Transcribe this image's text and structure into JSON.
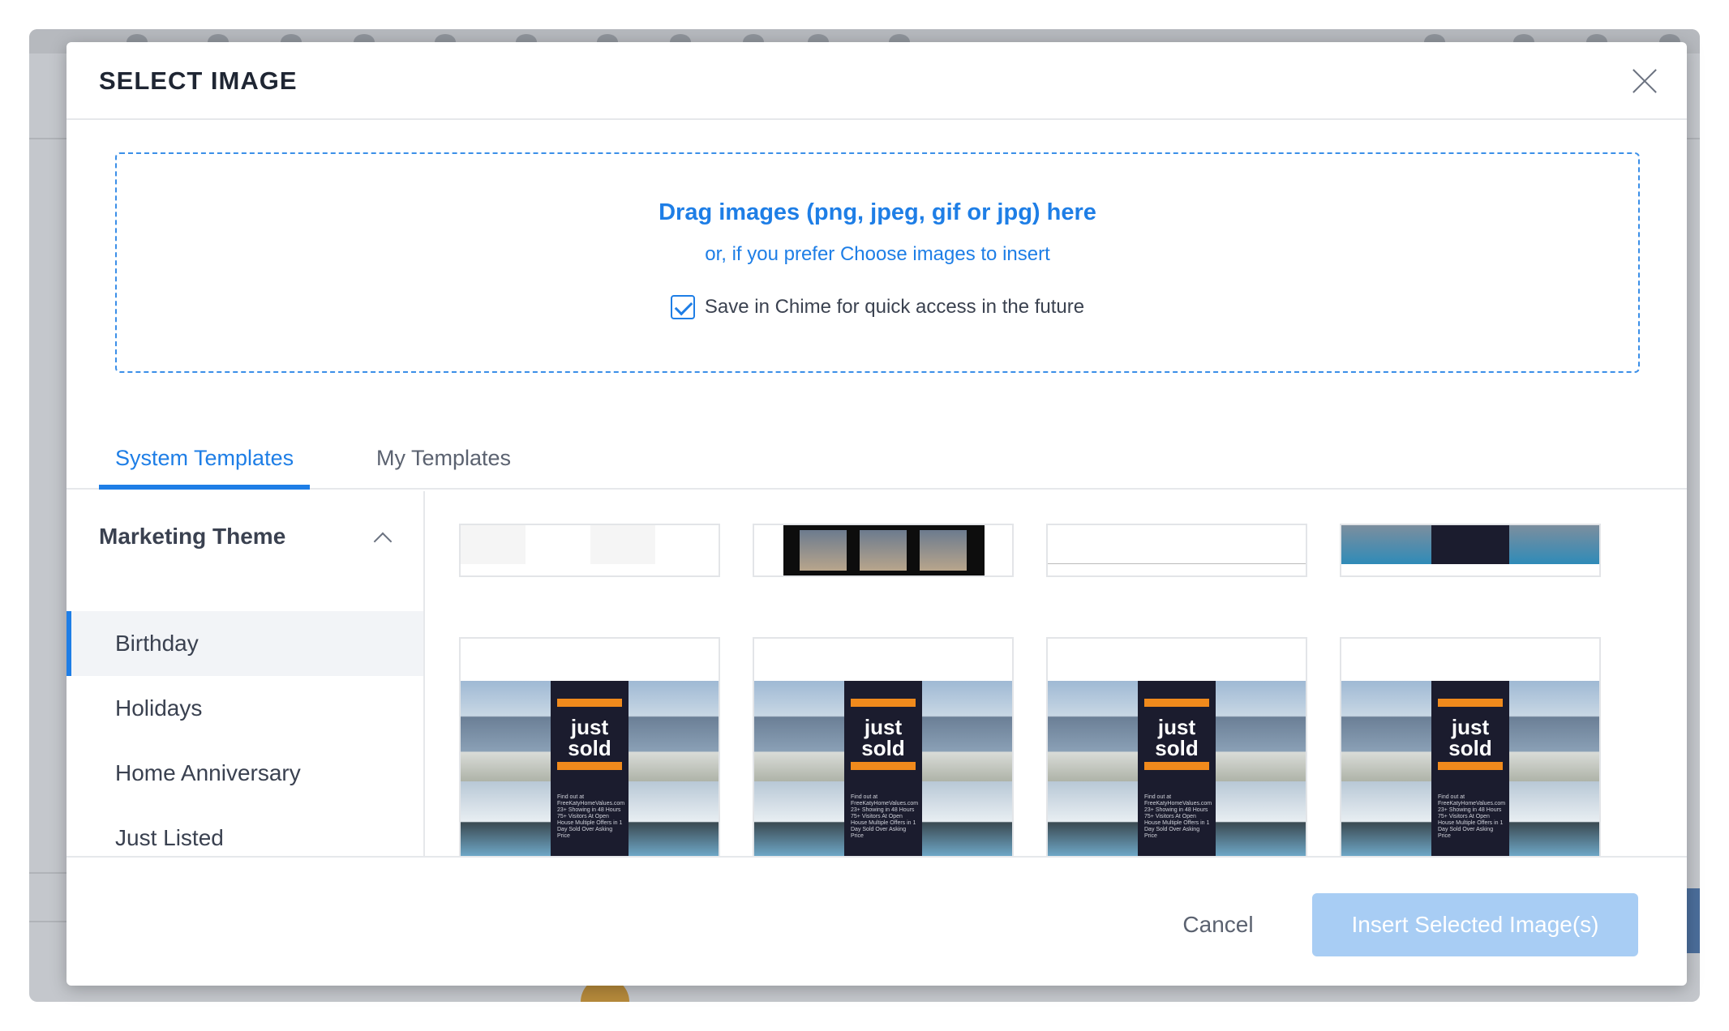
{
  "modal": {
    "title": "SELECT IMAGE",
    "dropzone": {
      "title": "Drag images (png, jpeg, gif or jpg) here",
      "subtitle": "or, if you prefer Choose images to insert",
      "save_label": "Save in Chime for quick access in the future",
      "save_checked": true
    },
    "tabs": [
      {
        "label": "System Templates",
        "active": true
      },
      {
        "label": "My Templates",
        "active": false
      }
    ],
    "sidebar": {
      "heading": "Marketing Theme",
      "items": [
        {
          "label": "Birthday",
          "active": true
        },
        {
          "label": "Holidays"
        },
        {
          "label": "Home Anniversary"
        },
        {
          "label": "Just Listed"
        }
      ]
    },
    "templates": {
      "just_sold_word1": "just",
      "just_sold_word2": "sold",
      "just_sold_fine": "Find out at FreeKatyHomeValues.com 23+ Showing in 48 Hours 75+ Visitors At Open House Multiple Offers in 1 Day Sold Over Asking Price"
    },
    "footer": {
      "cancel_label": "Cancel",
      "insert_label": "Insert Selected Image(s)"
    }
  },
  "colors": {
    "accent": "#1e7ee6",
    "insert_disabled": "#a8cdf4",
    "panel_dark": "#1b1c2e",
    "orange_bar": "#f08a1c"
  }
}
